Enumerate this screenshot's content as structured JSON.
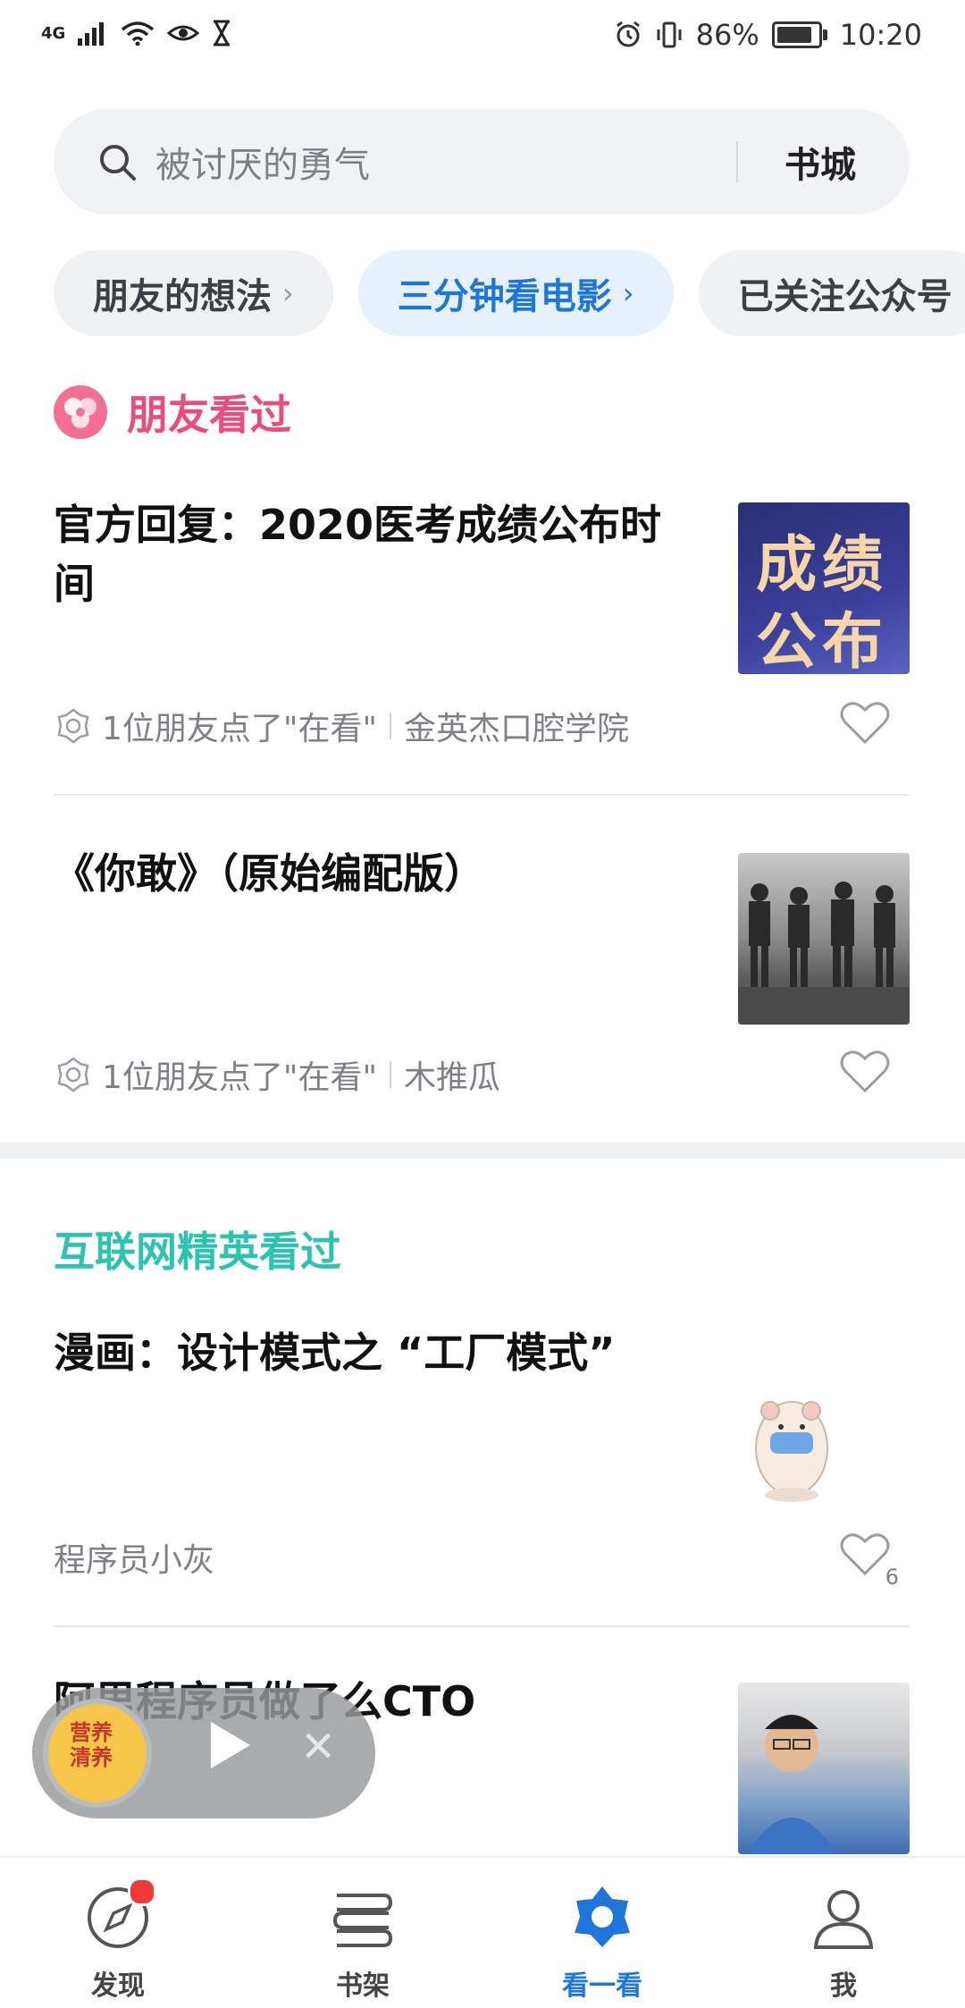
{
  "status_bar": {
    "network": "4G",
    "battery": "86%",
    "battery_level": 0.86,
    "time": "10:20"
  },
  "search": {
    "placeholder": "被讨厌的勇气",
    "store_label": "书城"
  },
  "chips": [
    {
      "label": "朋友的想法",
      "active": false
    },
    {
      "label": "三分钟看电影",
      "active": true
    },
    {
      "label": "已关注公众号",
      "active": false
    }
  ],
  "friends_section": {
    "heading": "朋友看过",
    "articles": [
      {
        "title": "官方回复：2020医考成绩公布时间",
        "thumb_text_1": "成绩",
        "thumb_text_2": "公布",
        "meta": "1位朋友点了\"在看\"",
        "source": "金英杰口腔学院"
      },
      {
        "title": "《你敢》（原始编配版）",
        "meta": "1位朋友点了\"在看\"",
        "source": "木推瓜"
      }
    ]
  },
  "elite_section": {
    "heading": "互联网精英看过",
    "articles": [
      {
        "title": "漫画：设计模式之 “工厂模式”",
        "source": "程序员小灰",
        "likes": "6"
      },
      {
        "title": "阿里程序员做了么CTO"
      }
    ]
  },
  "player": {
    "cover_text": "营养清养"
  },
  "tabbar": [
    {
      "label": "发现",
      "icon": "compass-icon",
      "active": false,
      "badge": true
    },
    {
      "label": "书架",
      "icon": "bookshelf-icon",
      "active": false
    },
    {
      "label": "看一看",
      "icon": "look-icon",
      "active": true
    },
    {
      "label": "我",
      "icon": "person-icon",
      "active": false
    }
  ],
  "colors": {
    "accent_blue": "#1e76d8",
    "friends_pink": "#ec4b7e",
    "elite_teal": "#2cc3b0",
    "badge_red": "#f2383b"
  }
}
